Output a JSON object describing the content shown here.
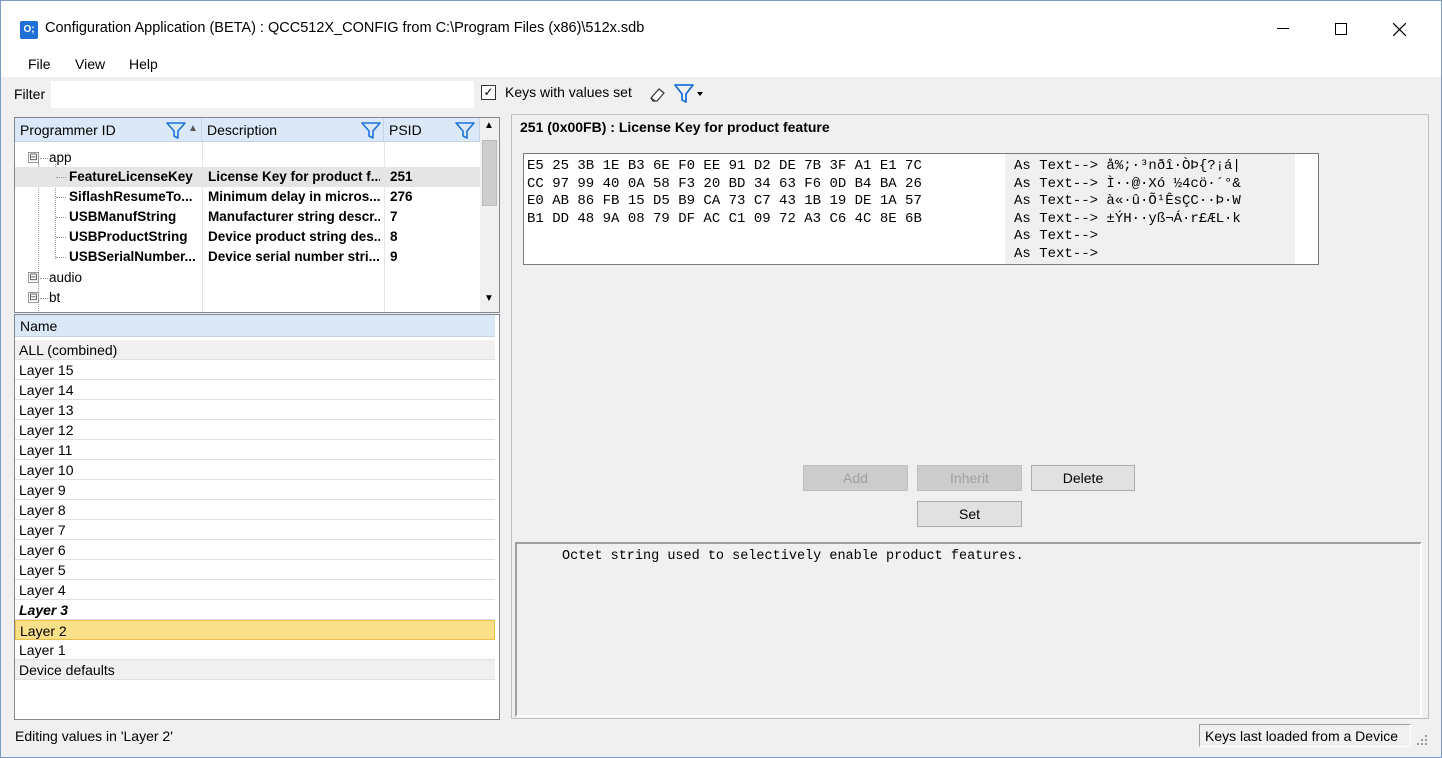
{
  "window": {
    "title": "Configuration Application (BETA) : QCC512X_CONFIG from C:\\Program Files (x86)\\512x.sdb",
    "icon_label": "O;",
    "minimize": "—",
    "maximize": "☐",
    "close": "✕"
  },
  "menu": {
    "file": "File",
    "view": "View",
    "help": "Help"
  },
  "filter": {
    "label": "Filter",
    "value": "",
    "keys_with_values_label": "Keys with values set",
    "keys_with_values_checked": "✓"
  },
  "grid": {
    "columns": [
      {
        "label": "Programmer ID"
      },
      {
        "label": "Description"
      },
      {
        "label": "PSID"
      }
    ],
    "groups": {
      "app": "app",
      "audio": "audio",
      "bt": "bt",
      "expander": "⊟"
    },
    "rows": [
      {
        "id": "FeatureLicenseKey",
        "desc": "License Key for product f...",
        "psid": "251"
      },
      {
        "id": "SiflashResumeTo...",
        "desc": "Minimum delay in micros...",
        "psid": "276"
      },
      {
        "id": "USBManufString",
        "desc": "Manufacturer string descr...",
        "psid": "7"
      },
      {
        "id": "USBProductString",
        "desc": "Device product string des...",
        "psid": "8"
      },
      {
        "id": "USBSerialNumber...",
        "desc": "Device serial number stri...",
        "psid": "9"
      }
    ],
    "scroll_up": "▲",
    "scroll_down": "▼",
    "sort_arrow": "▲"
  },
  "layers": {
    "header": "Name",
    "items": [
      "ALL (combined)",
      "Layer 15",
      "Layer 14",
      "Layer 13",
      "Layer 12",
      "Layer 11",
      "Layer 10",
      "Layer 9",
      "Layer 8",
      "Layer 7",
      "Layer 6",
      "Layer 5",
      "Layer 4",
      "Layer 3",
      "Layer 2",
      "Layer 1",
      "Device defaults"
    ]
  },
  "detail": {
    "heading": "251 (0x00FB) : License Key for product feature",
    "hex_lines": [
      "E5 25 3B 1E B3 6E F0 EE 91 D2 DE 7B 3F A1 E1 7C",
      "CC 97 99 40 0A 58 F3 20 BD 34 63 F6 0D B4 BA 26",
      "E0 AB 86 FB 15 D5 B9 CA 73 C7 43 1B 19 DE 1A 57",
      "B1 DD 48 9A 08 79 DF AC C1 09 72 A3 C6 4C 8E 6B"
    ],
    "text_lines": [
      "As Text--> å%;·³nðî·ÒÞ{?¡á|",
      "As Text--> Ì··@·Xó ½4cö·´°&",
      "As Text--> à«·û·Õ¹ÊsÇC··Þ·W",
      "As Text--> ±ÝH··yß¬Á·r£ÆL·k",
      "As Text-->",
      "As Text-->"
    ],
    "buttons": {
      "add": "Add",
      "inherit": "Inherit",
      "delete": "Delete",
      "set": "Set"
    },
    "description": "Octet string used to selectively enable product features."
  },
  "status": {
    "left": "Editing values in 'Layer 2'",
    "right": "Keys last loaded from a Device"
  },
  "colors": {
    "header_bg": "#dbe8f7",
    "selected_layer": "#fbe08a",
    "funnel_blue": "#1e73d8"
  }
}
